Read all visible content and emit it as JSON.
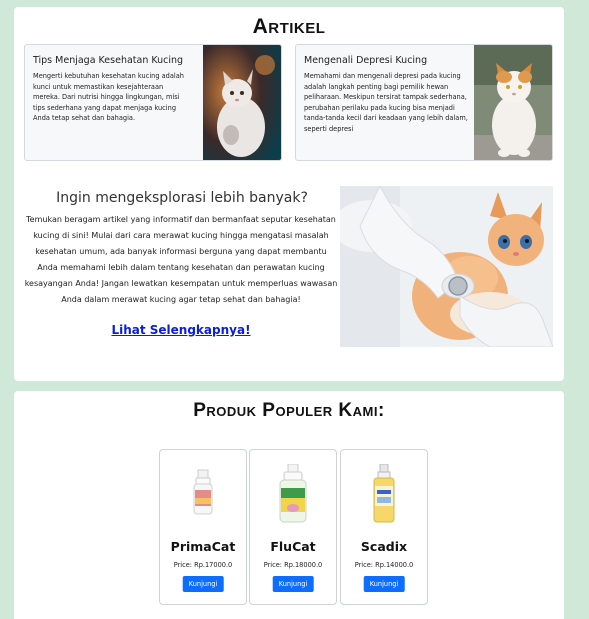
{
  "articles_section": {
    "title": "Artikel",
    "cards": [
      {
        "title": "Tips Menjaga Kesehatan Kucing",
        "text": "Mengerti kebutuhan kesehatan kucing adalah kunci untuk memastikan kesejahteraan mereka. Dari nutrisi hingga lingkungan, misi tips sederhana yang dapat menjaga kucing Anda tetap sehat dan bahagia."
      },
      {
        "title": "Mengenali Depresi Kucing",
        "text": "Memahami dan mengenali depresi pada kucing adalah langkah penting bagi pemilik hewan peliharaan. Meskipun tersirat tampak sederhana, perubahan perilaku pada kucing bisa menjadi tanda-tanda kecil dari keadaan yang lebih dalam, seperti depresi"
      }
    ],
    "explore": {
      "heading": "Ingin mengeksplorasi lebih banyak?",
      "text": "Temukan beragam artikel yang informatif dan bermanfaat seputar kesehatan kucing di sini! Mulai dari cara merawat kucing hingga mengatasi masalah kesehatan umum, ada banyak informasi berguna yang dapat membantu Anda memahami lebih dalam tentang kesehatan dan perawatan kucing kesayangan Anda! Jangan lewatkan kesempatan untuk memperluas wawasan Anda dalam merawat kucing agar tetap sehat dan bahagia!",
      "link_label": "Lihat Selengkapnya!"
    }
  },
  "products_section": {
    "title": "Produk Populer Kami:",
    "products": [
      {
        "name": "PrimaCat",
        "price": "Price: Rp.17000.0",
        "button": "Kunjungi"
      },
      {
        "name": "FluCat",
        "price": "Price: Rp.18000.0",
        "button": "Kunjungi"
      },
      {
        "name": "Scadix",
        "price": "Price: Rp.14000.0",
        "button": "Kunjungi"
      }
    ]
  },
  "colors": {
    "page_background": "#cfe8d7",
    "link": "#0a1ed8",
    "button": "#0d6efd"
  }
}
